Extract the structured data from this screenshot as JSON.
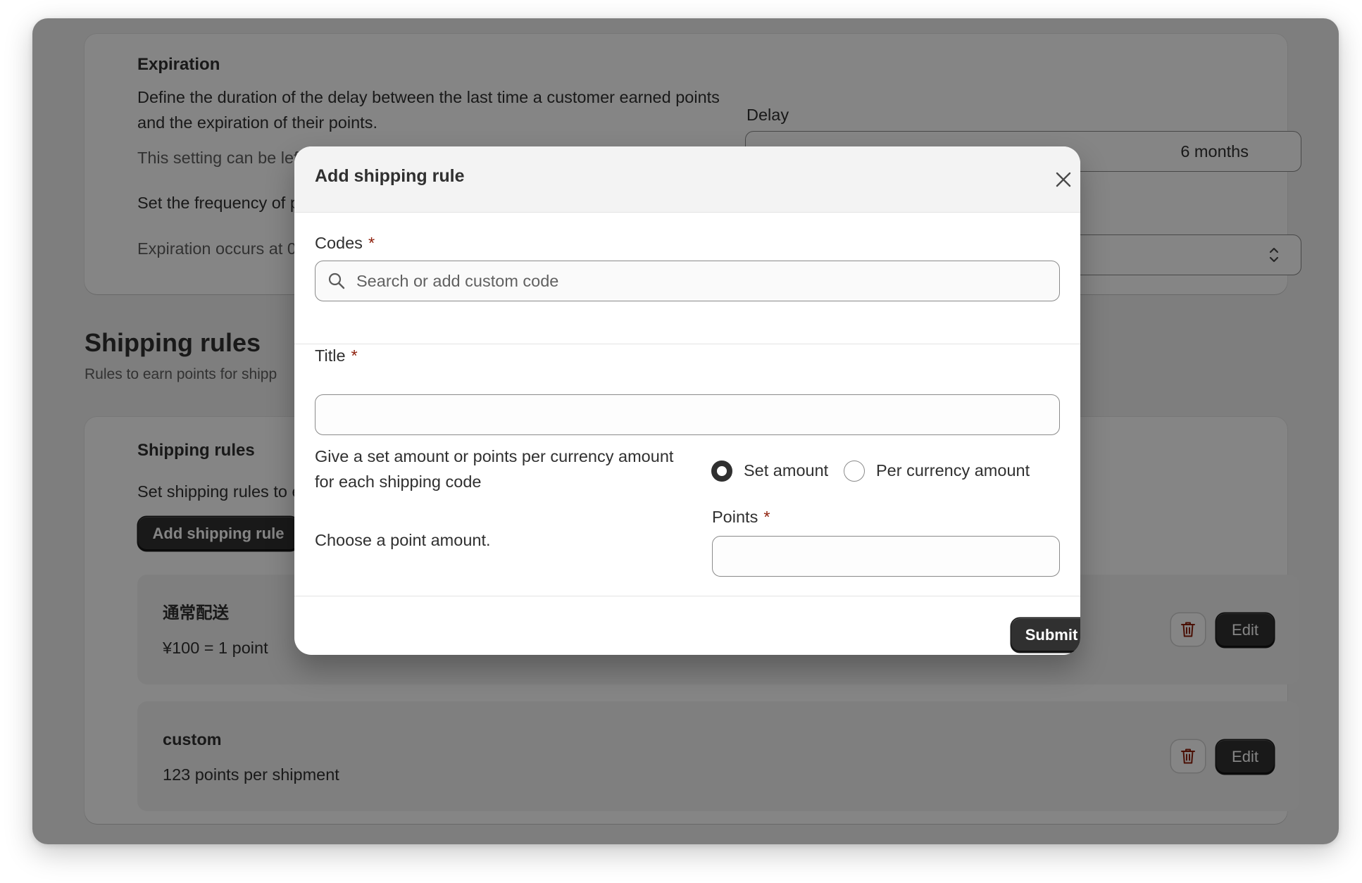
{
  "background": {
    "expiration": {
      "title": "Expiration",
      "description": "Define the duration of the delay between the last time a customer earned points and the expiration of their points.",
      "note_fragment": "This setting can be left b",
      "frequency_fragment": "Set the frequency of poi",
      "time_fragment": "Expiration occurs at 00:0",
      "delay_label": "Delay",
      "delay_value": "6 months"
    },
    "shipping_section": {
      "heading": "Shipping rules",
      "subheading_fragment": "Rules to earn points for shipp"
    },
    "shipping_card": {
      "title": "Shipping rules",
      "description_fragment": "Set shipping rules to ear",
      "add_button": "Add shipping rule",
      "rules": [
        {
          "name": "通常配送",
          "detail": "¥100 = 1 point",
          "edit_label": "Edit"
        },
        {
          "name": "custom",
          "detail": "123 points per shipment",
          "edit_label": "Edit"
        }
      ]
    }
  },
  "modal": {
    "title": "Add shipping rule",
    "codes": {
      "label": "Codes",
      "required": "*",
      "placeholder": "Search or add custom code"
    },
    "title_field": {
      "label": "Title",
      "required": "*",
      "value": ""
    },
    "amount_help": "Give a set amount or points per currency amount for each shipping code",
    "amount_type": {
      "options": [
        "Set amount",
        "Per currency amount"
      ],
      "selected": "Set amount"
    },
    "points_help": "Choose a point amount.",
    "points": {
      "label": "Points",
      "required": "*",
      "value": ""
    },
    "submit_label": "Submit"
  },
  "colors": {
    "primary_button": "#303030",
    "required_marker": "#8e1f0b",
    "delete_icon": "#8e1f0b",
    "overlay": "rgba(0,0,0,0.48)"
  }
}
